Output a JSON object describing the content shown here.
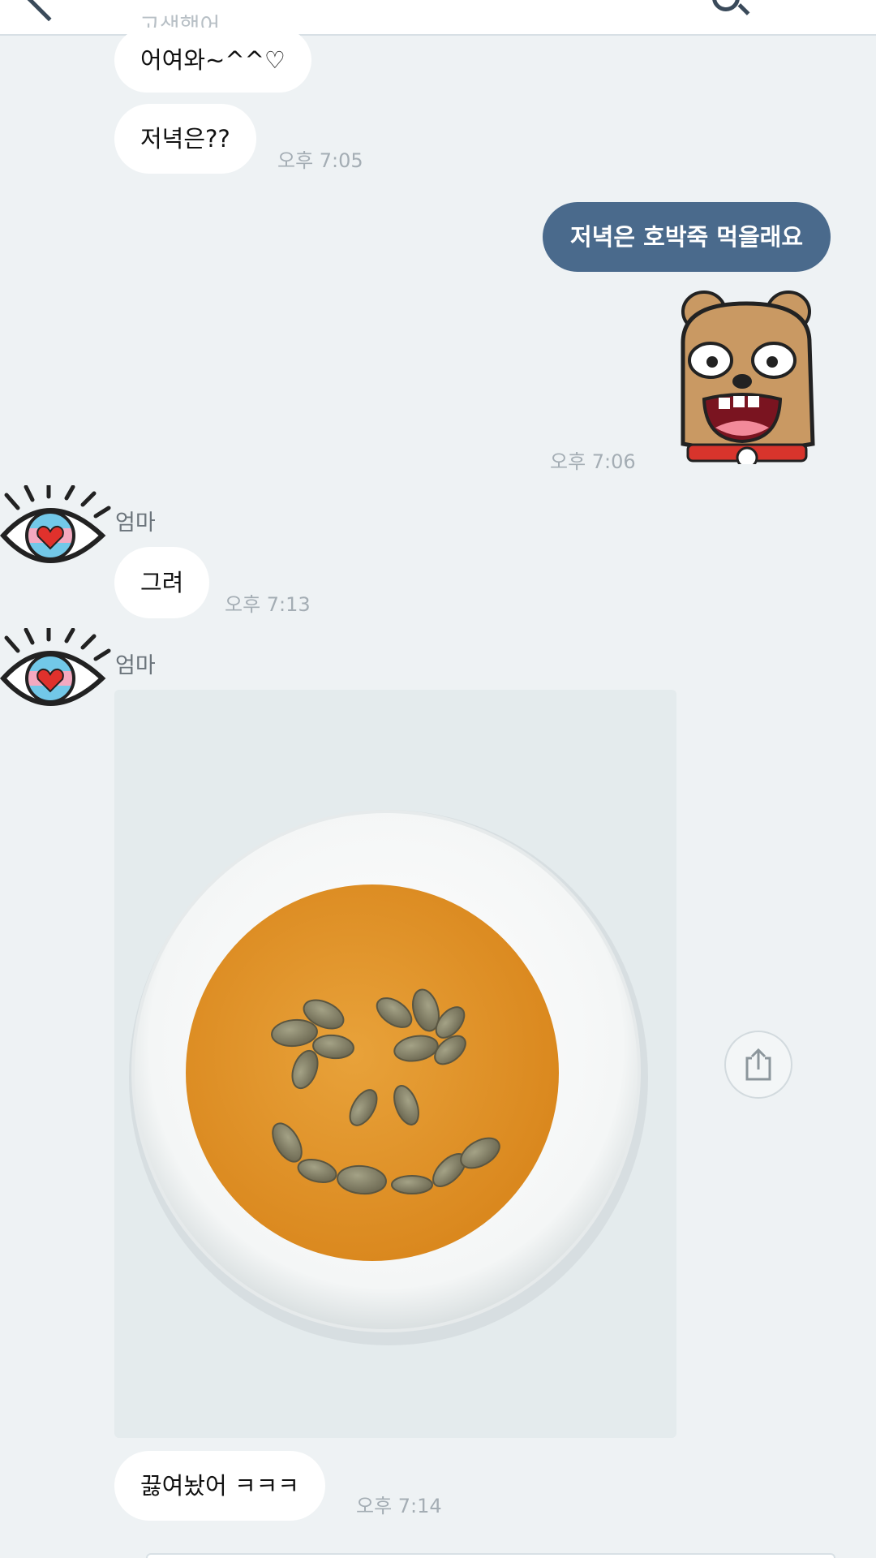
{
  "header": {
    "back_icon": "chevron-left-icon",
    "search_icon": "search-icon",
    "menu_icon": "menu-icon"
  },
  "messages": {
    "cut_off_text": "고생했어",
    "m1_text": "어여와~^^♡",
    "m2_text": "저녁은??",
    "m2_time": "오후 7:05",
    "m3_text": "저녁은 호박죽 먹을래요",
    "m4_sticker": "bear-sticker",
    "m4_time": "오후 7:06",
    "sender_name_1": "엄마",
    "m5_text": "그려",
    "m5_time": "오후 7:13",
    "sender_name_2": "엄마",
    "m6_photo": "pumpkin-porridge-smiley-photo",
    "m7_text": "끓여놨어  ㅋㅋㅋ",
    "m7_time": "오후 7:14"
  },
  "colors": {
    "background": "#eef2f4",
    "my_bubble": "#4a6a8c",
    "their_bubble": "#ffffff"
  }
}
